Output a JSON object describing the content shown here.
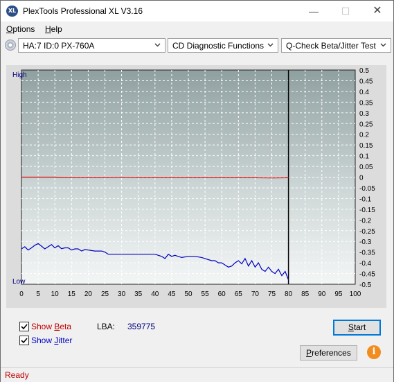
{
  "window": {
    "title": "PlexTools Professional XL V3.16",
    "app_icon_text": "XL"
  },
  "menubar": {
    "options": "Options",
    "options_hotkey": "O",
    "options_rest": "ptions",
    "help_hotkey": "H",
    "help_rest": "elp"
  },
  "toolbar": {
    "drive": "HA:7 ID:0  PX-760A",
    "function": "CD Diagnostic Functions",
    "test": "Q-Check Beta/Jitter Test"
  },
  "chart_data": {
    "type": "line",
    "ylabel_top": "High",
    "ylabel_bottom": "Low",
    "x_ticks": [
      "0",
      "5",
      "10",
      "15",
      "20",
      "25",
      "30",
      "35",
      "40",
      "45",
      "50",
      "55",
      "60",
      "65",
      "70",
      "75",
      "80",
      "85",
      "90",
      "95",
      "100"
    ],
    "y_ticks": [
      "0.5",
      "0.45",
      "0.4",
      "0.35",
      "0.3",
      "0.25",
      "0.2",
      "0.15",
      "0.1",
      "0.05",
      "0",
      "-0.05",
      "-0.1",
      "-0.15",
      "-0.2",
      "-0.25",
      "-0.3",
      "-0.35",
      "-0.4",
      "-0.45",
      "-0.5"
    ],
    "xlim": [
      0,
      100
    ],
    "ylim": [
      -0.5,
      0.5
    ],
    "end_marker_x": 80,
    "grid": true,
    "series": [
      {
        "name": "Beta",
        "color": "#e00000",
        "x": [
          0,
          5,
          10,
          15,
          20,
          25,
          30,
          35,
          40,
          45,
          50,
          55,
          60,
          65,
          70,
          75,
          80
        ],
        "y": [
          0.0,
          0.0,
          0.0,
          -0.003,
          -0.003,
          -0.003,
          -0.001,
          -0.003,
          -0.003,
          -0.003,
          -0.003,
          -0.003,
          -0.003,
          -0.003,
          -0.003,
          -0.004,
          -0.003
        ]
      },
      {
        "name": "Jitter",
        "color": "#0000c0",
        "x": [
          0,
          1,
          2,
          3,
          4,
          5,
          6,
          7,
          8,
          9,
          10,
          11,
          12,
          13,
          14,
          15,
          16,
          17,
          18,
          19,
          20,
          22,
          24,
          25,
          26,
          28,
          30,
          32,
          35,
          38,
          40,
          42,
          43,
          44,
          45,
          46,
          48,
          50,
          52,
          54,
          55,
          56,
          57,
          58,
          59,
          60,
          61,
          62,
          63,
          64,
          65,
          66,
          67,
          68,
          69,
          70,
          71,
          72,
          73,
          74,
          75,
          76,
          77,
          78,
          79,
          80
        ],
        "y": [
          -0.335,
          -0.325,
          -0.34,
          -0.33,
          -0.318,
          -0.31,
          -0.322,
          -0.335,
          -0.325,
          -0.315,
          -0.33,
          -0.32,
          -0.334,
          -0.33,
          -0.33,
          -0.34,
          -0.335,
          -0.335,
          -0.345,
          -0.338,
          -0.34,
          -0.345,
          -0.345,
          -0.35,
          -0.36,
          -0.36,
          -0.36,
          -0.36,
          -0.36,
          -0.36,
          -0.36,
          -0.37,
          -0.38,
          -0.36,
          -0.37,
          -0.365,
          -0.375,
          -0.37,
          -0.37,
          -0.375,
          -0.38,
          -0.385,
          -0.39,
          -0.39,
          -0.4,
          -0.4,
          -0.41,
          -0.42,
          -0.415,
          -0.4,
          -0.39,
          -0.405,
          -0.38,
          -0.415,
          -0.39,
          -0.42,
          -0.4,
          -0.43,
          -0.44,
          -0.42,
          -0.44,
          -0.45,
          -0.43,
          -0.46,
          -0.44,
          -0.48
        ]
      }
    ]
  },
  "options": {
    "show_beta_label": "Show Beta",
    "show_beta_pre": "Show ",
    "show_beta_hot": "B",
    "show_beta_post": "eta",
    "show_jitter_label": "Show Jitter",
    "show_jitter_pre": "Show ",
    "show_jitter_hot": "J",
    "show_jitter_post": "itter",
    "beta_checked": true,
    "jitter_checked": true,
    "beta_color": "#c00000",
    "jitter_color": "#0000c0"
  },
  "lba": {
    "label": "LBA:",
    "value": "359775"
  },
  "buttons": {
    "start": "Start",
    "start_hot": "S",
    "start_rest": "tart",
    "preferences": "Preferences",
    "pref_hot": "P",
    "pref_rest": "references",
    "info": "i"
  },
  "status": {
    "text": "Ready"
  }
}
